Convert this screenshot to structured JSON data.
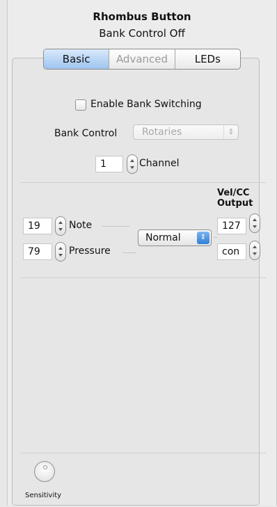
{
  "header": {
    "title": "Rhombus Button",
    "subtitle": "Bank Control Off"
  },
  "tabs": [
    {
      "label": "Basic",
      "active": true
    },
    {
      "label": "Advanced",
      "active": false,
      "disabled": true
    },
    {
      "label": "LEDs",
      "active": false
    }
  ],
  "bank": {
    "enable_label": "Enable Bank Switching",
    "enable_checked": false,
    "control_label": "Bank Control",
    "control_value": "Rotaries"
  },
  "channel": {
    "value": "1",
    "label": "Channel"
  },
  "output": {
    "header_line1": "Vel/CC",
    "header_line2": "Output",
    "note_value": "19",
    "note_label": "Note",
    "pressure_value": "79",
    "pressure_label": "Pressure",
    "mode_value": "Normal",
    "vel_value": "127",
    "cc_value": "con"
  },
  "sensitivity": {
    "label": "Sensitivity"
  },
  "colors": {
    "accent": "#9ec4ef",
    "popup_arrow": "#2f7fd6"
  }
}
